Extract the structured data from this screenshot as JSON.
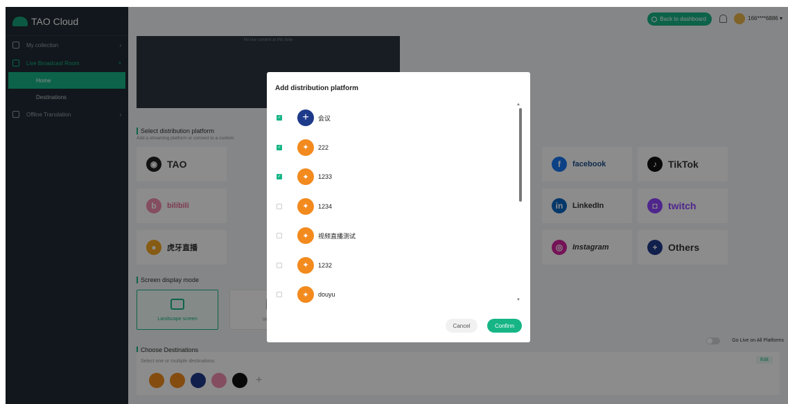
{
  "app": {
    "logo_text": "TAO Cloud"
  },
  "sidebar": {
    "items": [
      {
        "label": "My collection"
      },
      {
        "label": "Live Broadcast Room"
      },
      {
        "label": "Offline Translation"
      }
    ],
    "subitems": [
      {
        "label": "Home"
      },
      {
        "label": "Destinations"
      }
    ]
  },
  "topbar": {
    "back_label": "Back to dashboard",
    "phone": "166****6886",
    "dropdown_glyph": "▾"
  },
  "main": {
    "preview_text": "No live content at this time",
    "select_platform_title": "Select distribution platform",
    "select_platform_sub": "Add a streaming platform or connect to a custom",
    "platforms": [
      {
        "name": "TAO",
        "icon": "tao-logo-icon"
      },
      {
        "name": "facebook",
        "icon": "facebook-icon"
      },
      {
        "name": "TikTok",
        "icon": "tiktok-icon"
      },
      {
        "name": "bilibili",
        "icon": "bilibili-icon"
      },
      {
        "name": "LinkedIn",
        "icon": "linkedin-icon"
      },
      {
        "name": "twitch",
        "icon": "twitch-icon"
      },
      {
        "name": "虎牙直播",
        "icon": "huya-icon"
      },
      {
        "name": "Instagram",
        "icon": "instagram-icon"
      },
      {
        "name": "Others",
        "icon": "plus-icon"
      }
    ],
    "display_mode_title": "Screen display mode",
    "modes": [
      {
        "label": "Landscape screen"
      },
      {
        "label": "Vertical"
      }
    ],
    "destinations_title": "Choose Destinations",
    "go_live_label": "Go Live on All Platforms",
    "dest_hint": "Select one or multiple destinations",
    "edit_label": "Edit"
  },
  "modal": {
    "title": "Add distribution platform",
    "rows": [
      {
        "name": "会议",
        "checked": true,
        "icon": "plus-icon"
      },
      {
        "name": "222",
        "checked": true,
        "icon": "custom-avatar-icon"
      },
      {
        "name": "1233",
        "checked": true,
        "icon": "custom-avatar-icon"
      },
      {
        "name": "1234",
        "checked": false,
        "icon": "custom-avatar-icon"
      },
      {
        "name": "视频直播测试",
        "checked": false,
        "icon": "custom-avatar-icon"
      },
      {
        "name": "1232",
        "checked": false,
        "icon": "custom-avatar-icon"
      },
      {
        "name": "douyu",
        "checked": false,
        "icon": "custom-avatar-icon"
      }
    ],
    "cancel_label": "Cancel",
    "confirm_label": "Confirm"
  },
  "colors": {
    "accent": "#17b586",
    "sidebar_bg": "#1f2a33",
    "overlay": "rgba(0,0,0,0.45)"
  }
}
